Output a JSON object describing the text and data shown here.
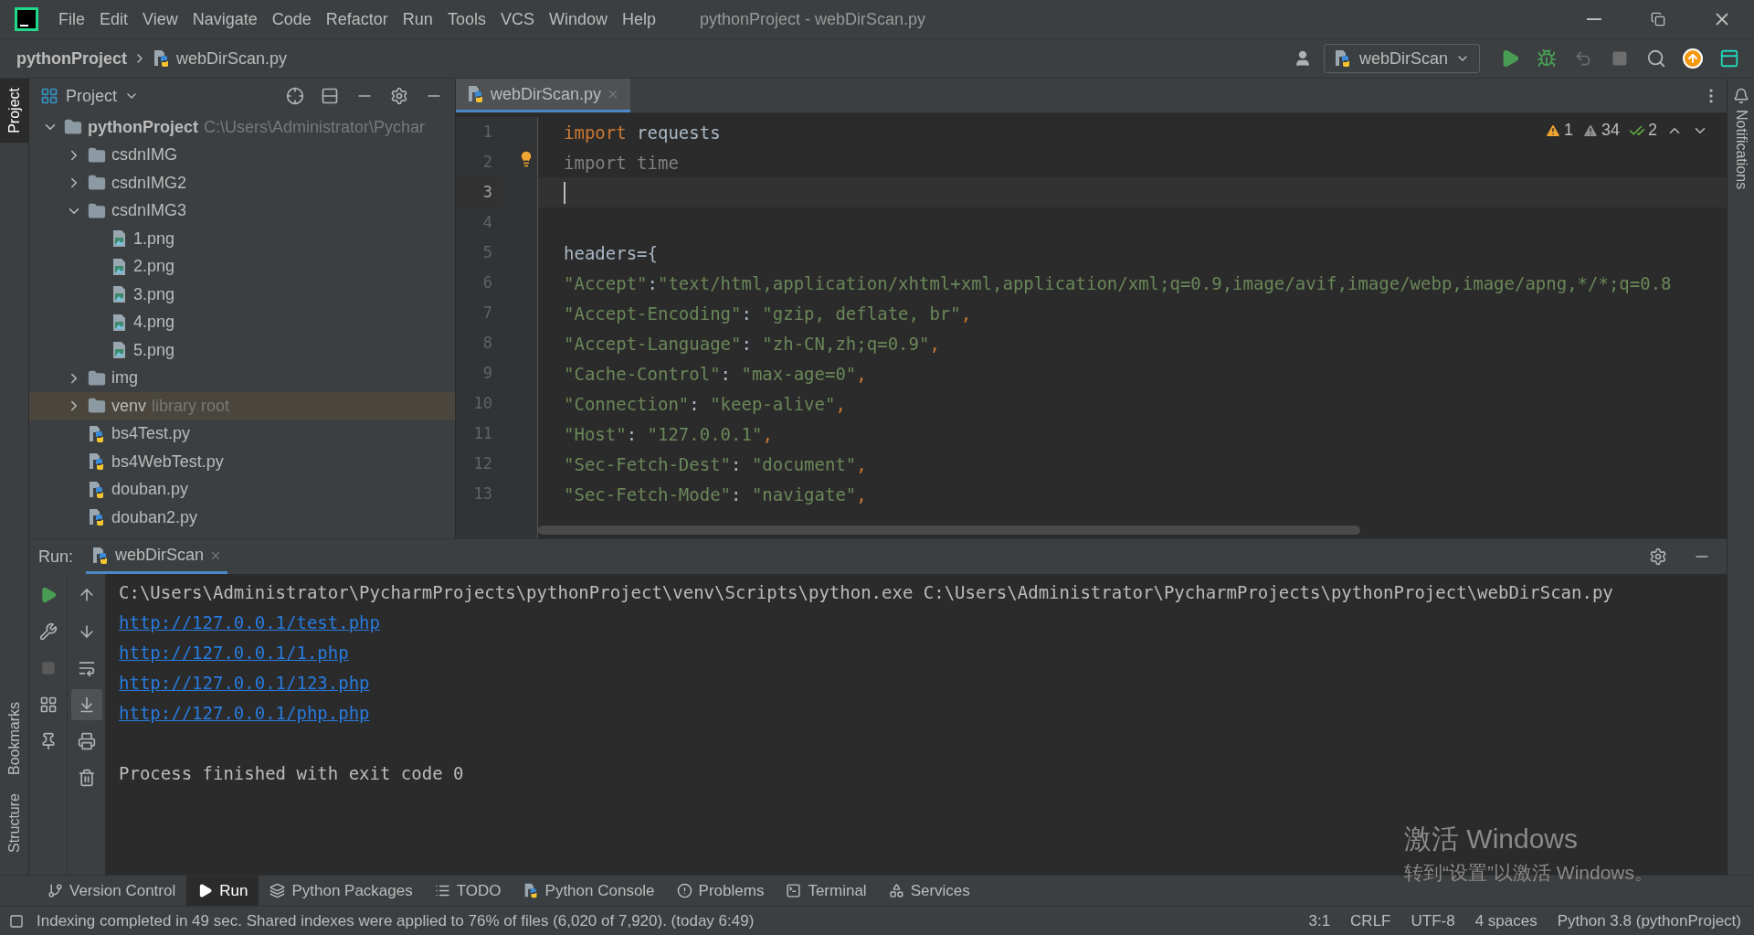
{
  "window": {
    "title": "pythonProject - webDirScan.py"
  },
  "menu": [
    "File",
    "Edit",
    "View",
    "Navigate",
    "Code",
    "Refactor",
    "Run",
    "Tools",
    "VCS",
    "Window",
    "Help"
  ],
  "breadcrumb": [
    "pythonProject",
    "webDirScan.py"
  ],
  "run_config": "webDirScan",
  "left_stripe": [
    {
      "label": "Project",
      "selected": true
    },
    {
      "label": "Bookmarks",
      "selected": false
    },
    {
      "label": "Structure",
      "selected": false
    }
  ],
  "right_stripe": [
    "Notifications"
  ],
  "project_panel": {
    "title": "Project",
    "tree": [
      {
        "label": "pythonProject",
        "hint": "C:\\Users\\Administrator\\Pychar",
        "kind": "folder",
        "bold": true,
        "expanded": true,
        "highlighted": false,
        "children": [
          {
            "label": "csdnIMG",
            "kind": "folder",
            "expanded": false,
            "highlighted": false
          },
          {
            "label": "csdnIMG2",
            "kind": "folder",
            "expanded": false,
            "highlighted": false
          },
          {
            "label": "csdnIMG3",
            "kind": "folder",
            "expanded": true,
            "highlighted": false,
            "children": [
              {
                "label": "1.png",
                "kind": "image",
                "highlighted": false
              },
              {
                "label": "2.png",
                "kind": "image",
                "highlighted": false
              },
              {
                "label": "3.png",
                "kind": "image",
                "highlighted": false
              },
              {
                "label": "4.png",
                "kind": "image",
                "highlighted": false
              },
              {
                "label": "5.png",
                "kind": "image",
                "highlighted": false
              }
            ]
          },
          {
            "label": "img",
            "kind": "folder",
            "expanded": false,
            "highlighted": false
          },
          {
            "label": "venv",
            "hint": "library root",
            "kind": "folder",
            "expanded": false,
            "highlighted": true
          },
          {
            "label": "bs4Test.py",
            "kind": "python",
            "highlighted": false
          },
          {
            "label": "bs4WebTest.py",
            "kind": "python",
            "highlighted": false
          },
          {
            "label": "douban.py",
            "kind": "python",
            "highlighted": false
          },
          {
            "label": "douban2.py",
            "kind": "python",
            "highlighted": false
          }
        ]
      }
    ]
  },
  "editor": {
    "tabs": [
      {
        "label": "webDirScan.py",
        "selected": true
      }
    ],
    "inspections": [
      {
        "kind": "warning",
        "count": "1"
      },
      {
        "kind": "weak",
        "count": "34"
      },
      {
        "kind": "typo",
        "count": "2"
      }
    ],
    "lines": [
      {
        "number": "1",
        "current": false,
        "tokens": [
          {
            "kind": "keyword",
            "text": "import"
          },
          {
            "kind": "plain",
            "text": " requests"
          }
        ]
      },
      {
        "number": "2",
        "current": false,
        "bulb": true,
        "tokens": [
          {
            "kind": "unused",
            "text": "import time"
          }
        ]
      },
      {
        "number": "3",
        "current": true
      },
      {
        "number": "4",
        "current": false
      },
      {
        "number": "5",
        "current": false,
        "tokens": [
          {
            "kind": "plain",
            "text": "headers="
          },
          {
            "kind": "plain",
            "text": "{"
          }
        ]
      },
      {
        "number": "6",
        "current": false,
        "tokens": [
          {
            "kind": "key",
            "text": "\"Accept\""
          },
          {
            "kind": "plain",
            "text": ":"
          },
          {
            "kind": "string",
            "text": "\"text/html,application/xhtml+xml,application/xml;q=0.9,image/avif,image/webp,image/apng,*/*;q=0.8"
          }
        ]
      },
      {
        "number": "7",
        "current": false,
        "tokens": [
          {
            "kind": "key",
            "text": "\"Accept-Encoding\""
          },
          {
            "kind": "plain",
            "text": ": "
          },
          {
            "kind": "string",
            "text": "\"gzip, deflate, br\""
          },
          {
            "kind": "punct",
            "text": ","
          }
        ]
      },
      {
        "number": "8",
        "current": false,
        "tokens": [
          {
            "kind": "key",
            "text": "\"Accept-Language\""
          },
          {
            "kind": "plain",
            "text": ": "
          },
          {
            "kind": "string",
            "text": "\"zh-CN,zh;q=0.9\""
          },
          {
            "kind": "punct",
            "text": ","
          }
        ]
      },
      {
        "number": "9",
        "current": false,
        "tokens": [
          {
            "kind": "key",
            "text": "\"Cache-Control\""
          },
          {
            "kind": "plain",
            "text": ": "
          },
          {
            "kind": "string",
            "text": "\"max-age=0\""
          },
          {
            "kind": "punct",
            "text": ","
          }
        ]
      },
      {
        "number": "10",
        "current": false,
        "tokens": [
          {
            "kind": "key",
            "text": "\"Connection\""
          },
          {
            "kind": "plain",
            "text": ": "
          },
          {
            "kind": "string",
            "text": "\"keep-alive\""
          },
          {
            "kind": "punct",
            "text": ","
          }
        ]
      },
      {
        "number": "11",
        "current": false,
        "tokens": [
          {
            "kind": "key",
            "text": "\"Host\""
          },
          {
            "kind": "plain",
            "text": ": "
          },
          {
            "kind": "string",
            "text": "\"127.0.0.1\""
          },
          {
            "kind": "punct",
            "text": ","
          }
        ]
      },
      {
        "number": "12",
        "current": false,
        "tokens": [
          {
            "kind": "key",
            "text": "\"Sec-Fetch-Dest\""
          },
          {
            "kind": "plain",
            "text": ": "
          },
          {
            "kind": "string",
            "text": "\"document\""
          },
          {
            "kind": "punct",
            "text": ","
          }
        ]
      },
      {
        "number": "13",
        "current": false,
        "tokens": [
          {
            "kind": "key",
            "text": "\"Sec-Fetch-Mode\""
          },
          {
            "kind": "plain",
            "text": ": "
          },
          {
            "kind": "string",
            "text": "\"navigate\""
          },
          {
            "kind": "punct",
            "text": ","
          }
        ]
      }
    ]
  },
  "run_panel": {
    "label": "Run:",
    "tabs": [
      {
        "label": "webDirScan",
        "selected": true
      }
    ],
    "tools": [
      {
        "kind": "up",
        "selected": false
      },
      {
        "kind": "down",
        "selected": false
      },
      {
        "kind": "wrap",
        "selected": false
      },
      {
        "kind": "scroll-end",
        "selected": true
      },
      {
        "kind": "print",
        "selected": false
      },
      {
        "kind": "trash",
        "selected": false
      }
    ],
    "output": [
      {
        "kind": "text",
        "text": "C:\\Users\\Administrator\\PycharmProjects\\pythonProject\\venv\\Scripts\\python.exe C:\\Users\\Administrator\\PycharmProjects\\pythonProject\\webDirScan.py"
      },
      {
        "kind": "link",
        "text": "http://127.0.0.1/test.php"
      },
      {
        "kind": "link",
        "text": "http://127.0.0.1/1.php"
      },
      {
        "kind": "link",
        "text": "http://127.0.0.1/123.php"
      },
      {
        "kind": "link",
        "text": "http://127.0.0.1/php.php"
      },
      {
        "kind": "blank"
      },
      {
        "kind": "text",
        "text": "Process finished with exit code 0"
      }
    ]
  },
  "tool_tabs": [
    {
      "label": "Version Control",
      "kind": "vcs",
      "selected": false
    },
    {
      "label": "Run",
      "kind": "run",
      "selected": true
    },
    {
      "label": "Python Packages",
      "kind": "packages",
      "selected": false
    },
    {
      "label": "TODO",
      "kind": "todo",
      "selected": false
    },
    {
      "label": "Python Console",
      "kind": "console",
      "selected": false
    },
    {
      "label": "Problems",
      "kind": "problems",
      "selected": false
    },
    {
      "label": "Terminal",
      "kind": "terminal",
      "selected": false
    },
    {
      "label": "Services",
      "kind": "services",
      "selected": false
    }
  ],
  "status_bar": {
    "message": "Indexing completed in 49 sec. Shared indexes were applied to 76% of files (6,020 of 7,920). (today 6:49)",
    "items": [
      "3:1",
      "CRLF",
      "UTF-8",
      "4 spaces",
      "Python 3.8 (pythonProject)"
    ]
  },
  "activation_notice": {
    "title": "激活 Windows",
    "body": "转到“设置”以激活 Windows。"
  }
}
